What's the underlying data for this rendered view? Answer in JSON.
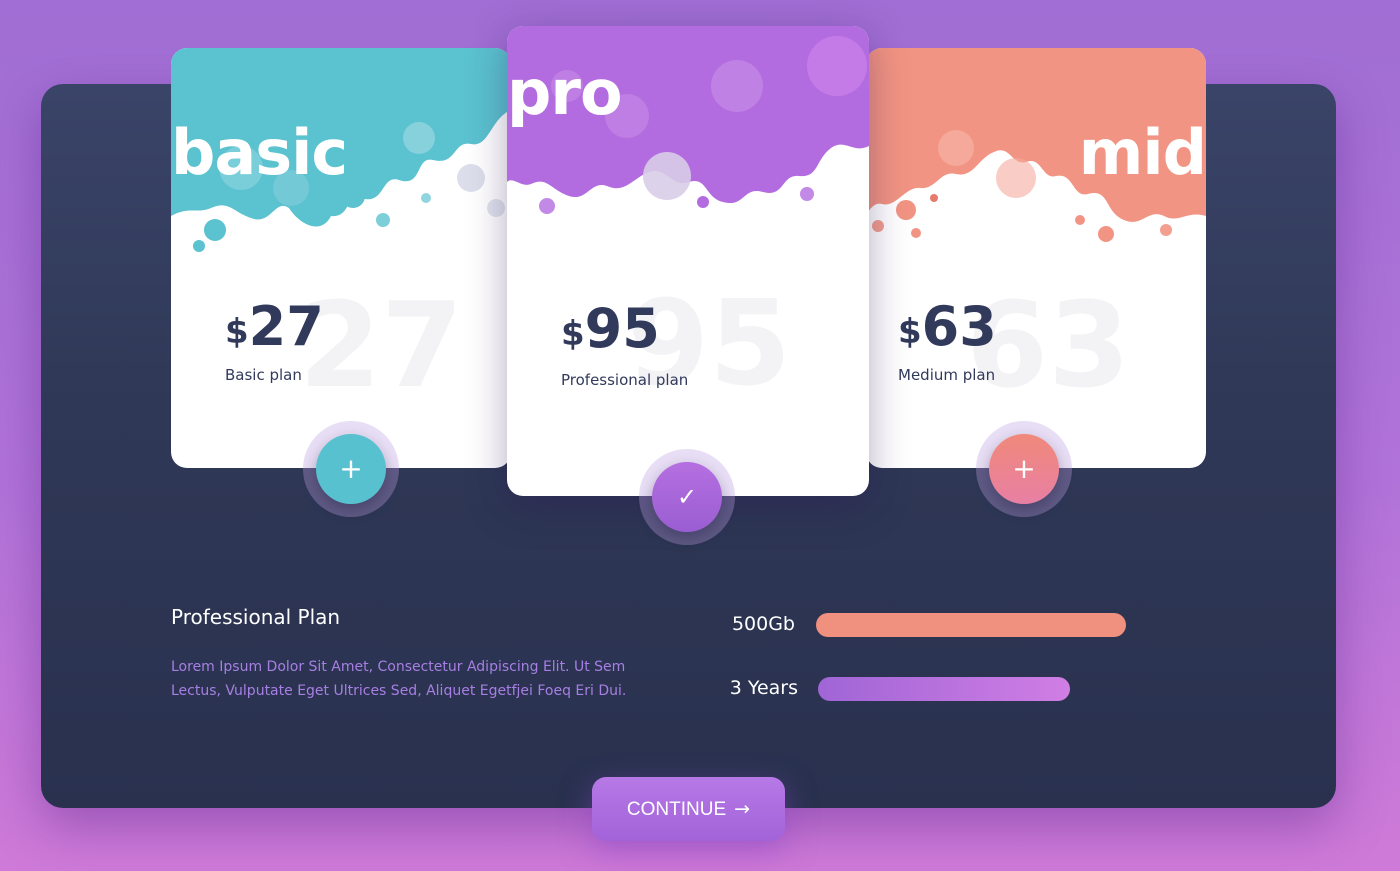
{
  "cards": {
    "basic": {
      "word": "basic",
      "currency": "$",
      "price": "27",
      "ghost": "27",
      "name": "Basic plan",
      "action_icon": "+",
      "color": "#5bc2cf"
    },
    "pro": {
      "word": "pro",
      "currency": "$",
      "price": "95",
      "ghost": "95",
      "name": "Professional plan",
      "action_icon": "✓",
      "color": "#b36ce0"
    },
    "mid": {
      "word": "mid",
      "currency": "$",
      "price": "63",
      "ghost": "63",
      "name": "Medium plan",
      "action_icon": "+",
      "color": "#f29483"
    }
  },
  "details": {
    "title": "Professional Plan",
    "description": "Lorem Ipsum Dolor Sit Amet, Consectetur Adipiscing Elit. Ut Sem Lectus, Vulputate Eget Ultrices Sed, Aliquet Egetfjei Foeq Eri Dui."
  },
  "stats": [
    {
      "label": "500Gb",
      "level": 1.0,
      "color": "#f0907e"
    },
    {
      "label": "3 Years",
      "level": 0.81,
      "color": "#b36ce0"
    }
  ],
  "continue_button": {
    "label": "CONTINUE",
    "icon": "→"
  },
  "background": {
    "panel": "#2f3856",
    "page": "#b173d9"
  }
}
